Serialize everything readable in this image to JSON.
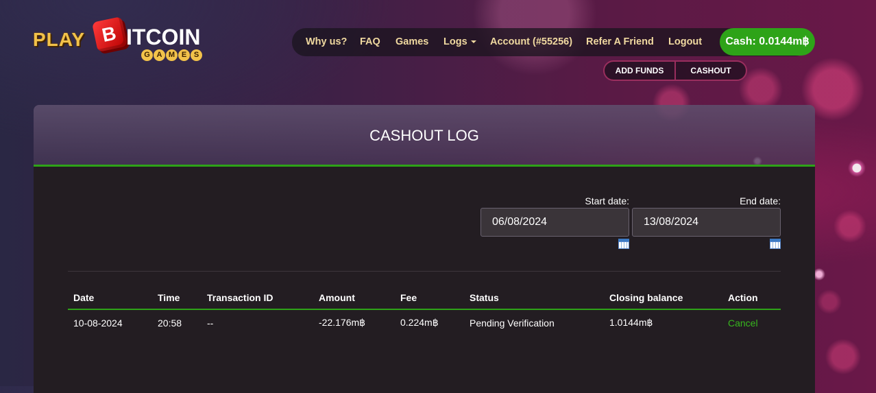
{
  "logo": {
    "play": "PLAY",
    "dice_letter": "B",
    "itcoin": "ITCOIN",
    "games_letters": [
      "G",
      "A",
      "M",
      "E",
      "S"
    ]
  },
  "nav": {
    "items": [
      {
        "label": "Why us?"
      },
      {
        "label": "FAQ"
      },
      {
        "label": "Games"
      },
      {
        "label": "Logs"
      },
      {
        "label": "Account (#55256)"
      },
      {
        "label": "Refer A Friend"
      },
      {
        "label": "Logout"
      }
    ],
    "cash": "Cash: 0.0144m฿",
    "add_funds": "ADD FUNDS",
    "cashout": "CASHOUT"
  },
  "panel": {
    "title": "CASHOUT LOG",
    "start_label": "Start date:",
    "start_value": "06/08/2024",
    "end_label": "End date:",
    "end_value": "13/08/2024"
  },
  "table": {
    "headers": [
      "Date",
      "Time",
      "Transaction ID",
      "Amount",
      "Fee",
      "Status",
      "Closing balance",
      "Action"
    ],
    "rows": [
      {
        "date": "10-08-2024",
        "time": "20:58",
        "transaction_id": "--",
        "amount": "-22.176m฿",
        "fee": "0.224m฿",
        "status": "Pending Verification",
        "closing_balance": "1.0144m฿",
        "action": "Cancel"
      }
    ]
  },
  "colors": {
    "accent_green": "#2ea318",
    "nav_text": "#f0d9a0",
    "panel_bg": "#231d22"
  }
}
